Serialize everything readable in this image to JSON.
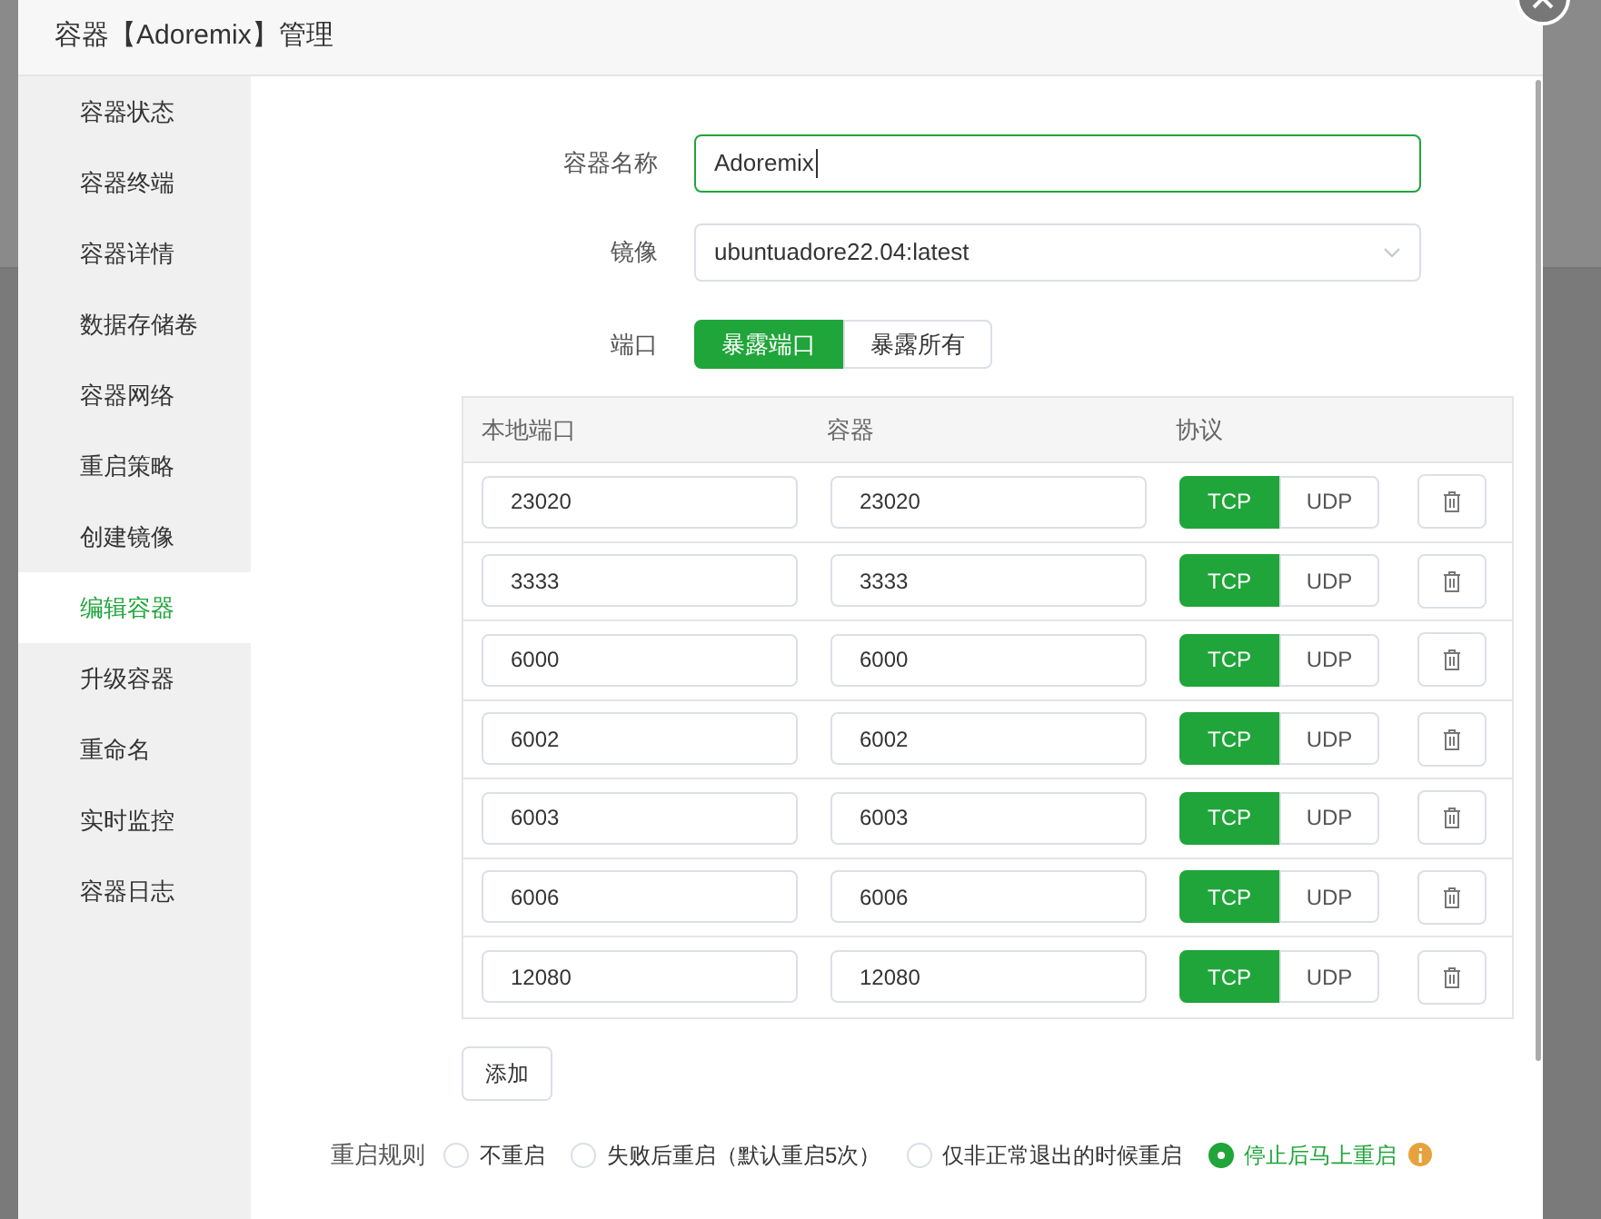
{
  "window": {
    "title": "容器【Adoremix】管理"
  },
  "sidebar": {
    "items": [
      {
        "label": "容器状态",
        "selected": false
      },
      {
        "label": "容器终端",
        "selected": false
      },
      {
        "label": "容器详情",
        "selected": false
      },
      {
        "label": "数据存储卷",
        "selected": false
      },
      {
        "label": "容器网络",
        "selected": false
      },
      {
        "label": "重启策略",
        "selected": false
      },
      {
        "label": "创建镜像",
        "selected": false
      },
      {
        "label": "编辑容器",
        "selected": true
      },
      {
        "label": "升级容器",
        "selected": false
      },
      {
        "label": "重命名",
        "selected": false
      },
      {
        "label": "实时监控",
        "selected": false
      },
      {
        "label": "容器日志",
        "selected": false
      }
    ]
  },
  "form": {
    "name": {
      "label": "容器名称",
      "value": "Adoremix"
    },
    "image": {
      "label": "镜像",
      "value": "ubuntuadore22.04:latest"
    },
    "ports": {
      "label": "端口",
      "modes": [
        {
          "label": "暴露端口",
          "selected": true
        },
        {
          "label": "暴露所有",
          "selected": false
        }
      ],
      "columns": [
        "本地端口",
        "容器",
        "协议"
      ],
      "rows": [
        {
          "local": "23020",
          "container": "23020",
          "protocols": [
            {
              "label": "TCP",
              "selected": true
            },
            {
              "label": "UDP",
              "selected": false
            }
          ]
        },
        {
          "local": "3333",
          "container": "3333",
          "protocols": [
            {
              "label": "TCP",
              "selected": true
            },
            {
              "label": "UDP",
              "selected": false
            }
          ]
        },
        {
          "local": "6000",
          "container": "6000",
          "protocols": [
            {
              "label": "TCP",
              "selected": true
            },
            {
              "label": "UDP",
              "selected": false
            }
          ]
        },
        {
          "local": "6002",
          "container": "6002",
          "protocols": [
            {
              "label": "TCP",
              "selected": true
            },
            {
              "label": "UDP",
              "selected": false
            }
          ]
        },
        {
          "local": "6003",
          "container": "6003",
          "protocols": [
            {
              "label": "TCP",
              "selected": true
            },
            {
              "label": "UDP",
              "selected": false
            }
          ]
        },
        {
          "local": "6006",
          "container": "6006",
          "protocols": [
            {
              "label": "TCP",
              "selected": true
            },
            {
              "label": "UDP",
              "selected": false
            }
          ]
        },
        {
          "local": "12080",
          "container": "12080",
          "protocols": [
            {
              "label": "TCP",
              "selected": true
            },
            {
              "label": "UDP",
              "selected": false
            }
          ]
        }
      ],
      "add_button": "添加"
    }
  },
  "restart": {
    "label": "重启规则",
    "options": [
      {
        "label": "不重启",
        "selected": false
      },
      {
        "label": "失败后重启（默认重启5次）",
        "selected": false
      },
      {
        "label": "仅非正常退出的时候重启",
        "selected": false
      },
      {
        "label": "停止后马上重启",
        "selected": true
      }
    ]
  }
}
